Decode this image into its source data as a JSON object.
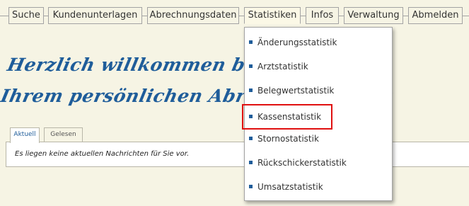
{
  "nav": {
    "items": [
      {
        "label": "Suche"
      },
      {
        "label": "Kundenunterlagen"
      },
      {
        "label": "Abrechnungsdaten"
      },
      {
        "label": "Statistiken",
        "active": true
      },
      {
        "label": "Infos"
      },
      {
        "label": "Verwaltung"
      },
      {
        "label": "Abmelden"
      }
    ]
  },
  "greeting": {
    "line1": "Herzlich willkommen bei der DZH,",
    "line2": "Ihrem persönlichen Abrechnungshaus"
  },
  "messages": {
    "tabs": [
      {
        "label": "Aktuell",
        "active": true
      },
      {
        "label": "Gelesen"
      }
    ],
    "empty_text": "Es liegen keine aktuellen Nachrichten für Sie vor."
  },
  "dropdown": {
    "items": [
      {
        "label": "Änderungsstatistik"
      },
      {
        "label": "Arztstatistik"
      },
      {
        "label": "Belegwertstatistik"
      },
      {
        "label": "Kassenstatistik",
        "highlighted": true
      },
      {
        "label": "Stornostatistik"
      },
      {
        "label": "Rückschickerstatistik"
      },
      {
        "label": "Umsatzstatistik"
      }
    ],
    "bullet_color": "#1f5d9a",
    "highlight_color": "#e01010"
  }
}
